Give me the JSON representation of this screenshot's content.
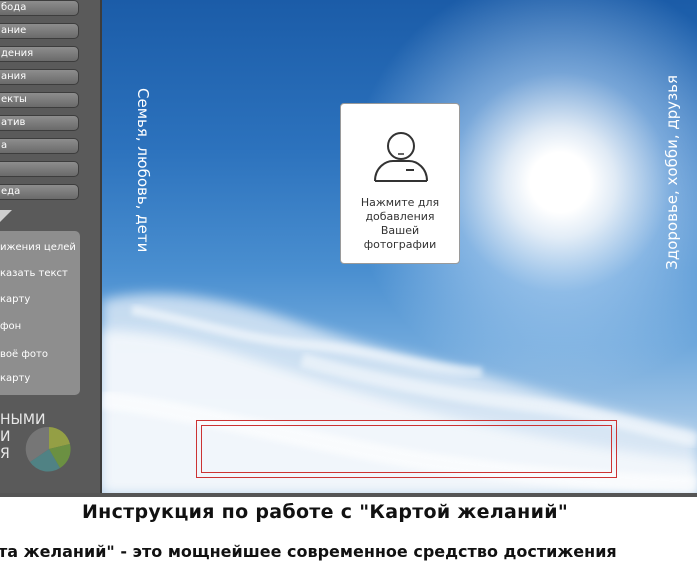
{
  "sidebar": {
    "menu_items": [
      "бода",
      "ание",
      "дения",
      "ания",
      "екты",
      "атив",
      "а",
      "",
      "еда"
    ],
    "actions": [
      "ижения целей",
      "казать текст",
      "карту",
      "фон",
      "воё фото",
      "карту"
    ],
    "brand_lines": [
      "НЫМИ",
      "И",
      "Я"
    ]
  },
  "canvas": {
    "left_label": "Семья, любовь, дети",
    "right_label": "Здоровье, хобби, друзья",
    "photo_prompt": [
      "Нажмите для",
      "добавления",
      "Вашей",
      "фотографии"
    ]
  },
  "document": {
    "title": "Инструкция по работе с \"Картой желаний\"",
    "intro": "та желаний\" - это мощнейшее современное средство достижения"
  },
  "colors": {
    "sidebar_bg": "#5a5a5a",
    "button_bg": "#7a7a7a",
    "actions_panel_bg": "#8e8e8e",
    "goal_border": "#cc3333",
    "sky_top": "#1b5ca8",
    "sky_bottom": "#a9c9e6"
  },
  "icons": {
    "photo": "person-icon",
    "brand": "pie-chart-logo",
    "collapse": "triangle-down-icon"
  }
}
